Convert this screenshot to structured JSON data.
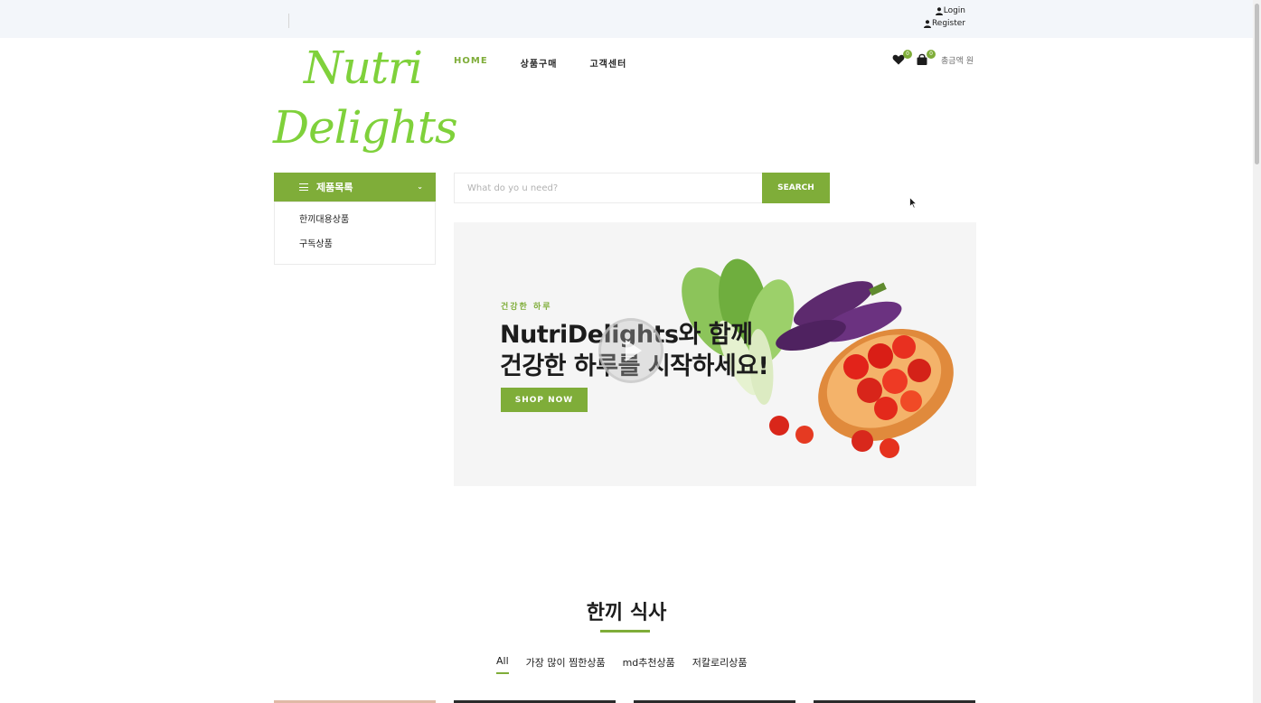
{
  "topbar": {
    "login_label": "Login",
    "register_label": "Register"
  },
  "logo": {
    "line1": "Nutri",
    "line2": "Delights"
  },
  "nav": {
    "items": [
      {
        "label": "HOME"
      },
      {
        "label": "상품구매"
      },
      {
        "label": "고객센터"
      }
    ]
  },
  "header_right": {
    "wishlist_count": "0",
    "cart_count": "0",
    "total_label": "총금액 원"
  },
  "categories": {
    "title": "제품목록",
    "items": [
      {
        "label": "한끼대용상품"
      },
      {
        "label": "구독상품"
      }
    ]
  },
  "search": {
    "placeholder": "What do yo u need?",
    "button_label": "SEARCH"
  },
  "hero": {
    "eyebrow": "건강한 하루",
    "title_line1": "NutriDelights와 함께",
    "title_line2": "건강한 하루를 시작하세요!",
    "button_label": "SHOP NOW"
  },
  "section": {
    "title": "한끼 식사",
    "filters": [
      {
        "label": "All"
      },
      {
        "label": "가장 많이 찜한상품"
      },
      {
        "label": "md추천상품"
      },
      {
        "label": "저칼로리상품"
      }
    ]
  },
  "colors": {
    "accent": "#7fad39",
    "logo": "#7fd13b",
    "topbar_bg": "#f3f6fa"
  }
}
